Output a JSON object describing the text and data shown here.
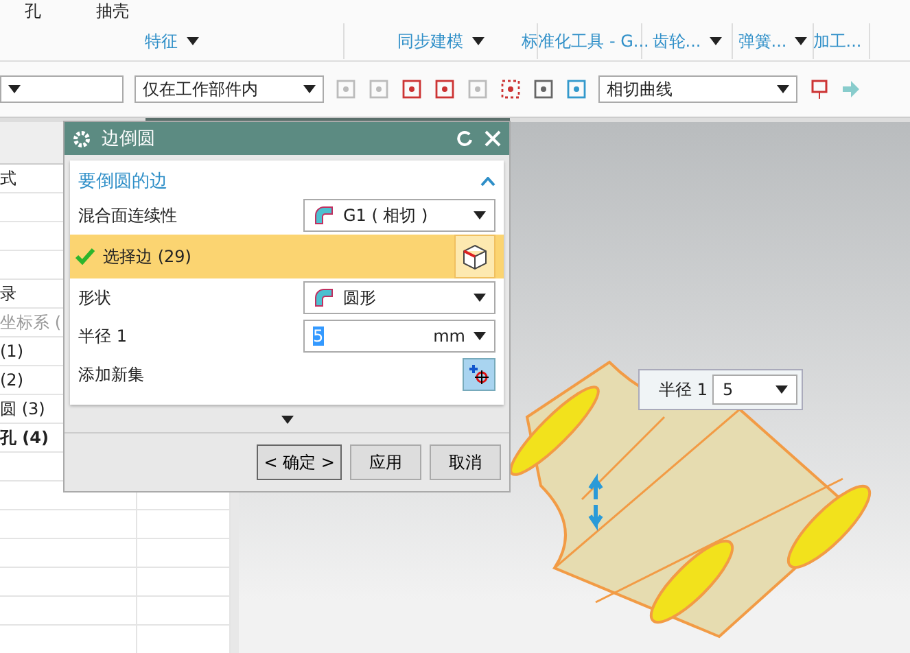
{
  "ribbon": {
    "top_labels": [
      "孔",
      "抽壳"
    ],
    "groups": [
      {
        "label": "特征"
      },
      {
        "label": "同步建模"
      },
      {
        "label": "标准化工具 - G..."
      },
      {
        "label": "齿轮..."
      },
      {
        "label": "弹簧..."
      },
      {
        "label": "加工..."
      }
    ]
  },
  "toolbar": {
    "scope_filter": "仅在工作部件内",
    "curve_rule": "相切曲线"
  },
  "navigator": {
    "rows": [
      {
        "text": "式",
        "kind": "normal"
      },
      {
        "text": "录",
        "kind": "normal"
      },
      {
        "text": "坐标系 (",
        "kind": "greyed"
      },
      {
        "text": "(1)",
        "kind": "normal"
      },
      {
        "text": "(2)",
        "kind": "normal"
      },
      {
        "text": "圆 (3)",
        "kind": "normal"
      },
      {
        "text": "孔 (4)",
        "kind": "bold"
      }
    ]
  },
  "dialog": {
    "title": "边倒圆",
    "section": {
      "title": "要倒圆的边",
      "expanded": true
    },
    "rows": [
      {
        "kind": "select",
        "label": "混合面连续性",
        "value": "G1 ( 相切 )"
      },
      {
        "kind": "selection",
        "label": "选择边 (29)",
        "selected": true
      },
      {
        "kind": "select",
        "label": "形状",
        "value": "圆形"
      },
      {
        "kind": "number",
        "label": "半径 1",
        "value": "5",
        "unit": "mm",
        "highlighted": true
      },
      {
        "kind": "action",
        "label": "添加新集"
      }
    ],
    "buttons": [
      {
        "label": "< 确定 >",
        "default": true
      },
      {
        "label": "应用",
        "default": false
      },
      {
        "label": "取消",
        "default": false
      }
    ]
  },
  "viewport": {
    "radius_label": "半径 1",
    "radius_value": "5"
  }
}
